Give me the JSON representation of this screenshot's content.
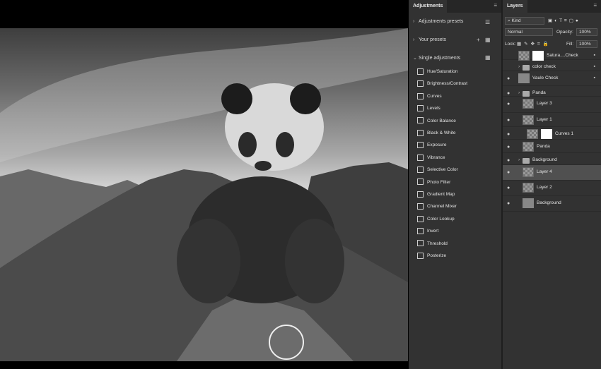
{
  "adjustments_panel": {
    "tab_label": "Adjustments",
    "menu_icon": "panel-menu-icon",
    "presets_label": "Adjustments presets",
    "your_presets_label": "Your presets",
    "single_label": "Single adjustments",
    "items": [
      {
        "label": "Hue/Saturation",
        "icon": "hue-saturation-icon"
      },
      {
        "label": "Brightness/Contrast",
        "icon": "brightness-contrast-icon"
      },
      {
        "label": "Curves",
        "icon": "curves-icon"
      },
      {
        "label": "Levels",
        "icon": "levels-icon"
      },
      {
        "label": "Color Balance",
        "icon": "color-balance-icon"
      },
      {
        "label": "Black & White",
        "icon": "black-white-icon"
      },
      {
        "label": "Exposure",
        "icon": "exposure-icon"
      },
      {
        "label": "Vibrance",
        "icon": "vibrance-icon"
      },
      {
        "label": "Selective Color",
        "icon": "selective-color-icon"
      },
      {
        "label": "Photo Filter",
        "icon": "photo-filter-icon"
      },
      {
        "label": "Gradient Map",
        "icon": "gradient-map-icon"
      },
      {
        "label": "Channel Mixer",
        "icon": "channel-mixer-icon"
      },
      {
        "label": "Color Lookup",
        "icon": "color-lookup-icon"
      },
      {
        "label": "Invert",
        "icon": "invert-icon"
      },
      {
        "label": "Threshold",
        "icon": "threshold-icon"
      },
      {
        "label": "Posterize",
        "icon": "posterize-icon"
      }
    ]
  },
  "layers_panel": {
    "tab_label": "Layers",
    "filter_label": "Kind",
    "blend_mode": "Normal",
    "opacity_label": "Opacity:",
    "opacity_value": "100%",
    "lock_label": "Lock:",
    "fill_label": "Fill:",
    "fill_value": "100%",
    "layers": [
      {
        "name": "Satura....Check",
        "visible": false,
        "locked": true
      },
      {
        "name": "color check",
        "visible": false,
        "locked": true
      },
      {
        "name": "Vaule Check",
        "visible": true,
        "locked": true
      },
      {
        "name": "Panda",
        "visible": true,
        "locked": false
      },
      {
        "name": "Layer 3",
        "visible": true,
        "locked": false
      },
      {
        "name": "Layer 1",
        "visible": true,
        "locked": false
      },
      {
        "name": "Curves 1",
        "visible": true,
        "locked": false
      },
      {
        "name": "Panda",
        "visible": true,
        "locked": false
      },
      {
        "name": "Background",
        "visible": true,
        "locked": false
      },
      {
        "name": "Layer 4",
        "visible": true,
        "locked": false,
        "selected": true
      },
      {
        "name": "Layer 2",
        "visible": true,
        "locked": false
      },
      {
        "name": "Background",
        "visible": true,
        "locked": false
      }
    ]
  }
}
